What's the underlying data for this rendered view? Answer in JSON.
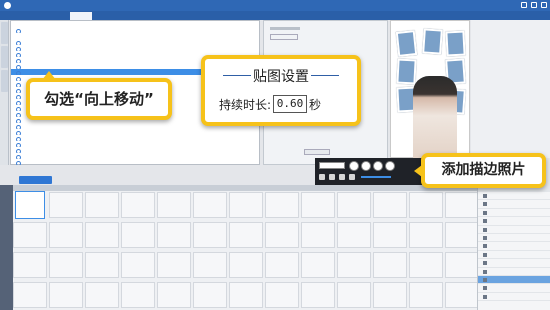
{
  "callouts": {
    "select_move_up": "勾选“向上移动”",
    "add_photo": "添加描边照片",
    "sticker_settings": {
      "title": "贴图设置",
      "duration_label": "持续时长:",
      "duration_value": "0.60",
      "unit": "秒"
    }
  },
  "colors": {
    "accent": "#f6c21a",
    "selection": "#3d8ee6",
    "title_bar": "#2f68b5"
  },
  "icons": [
    "app-logo-icon",
    "minimize-icon",
    "maximize-icon",
    "close-icon",
    "play-icon",
    "stop-icon",
    "prev-icon",
    "next-icon",
    "radio-icon",
    "sticker-thumb-icon"
  ]
}
